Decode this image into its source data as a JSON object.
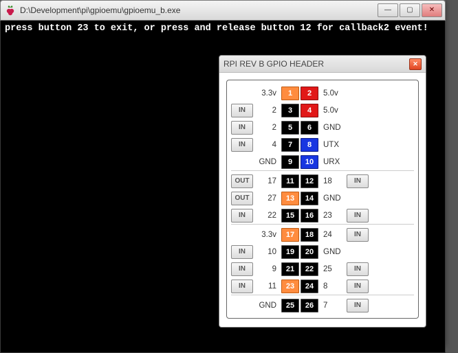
{
  "console": {
    "title_path": "D:\\Development\\pi\\gpioemu\\gpioemu_b.exe",
    "message": "press button 23 to exit, or press and release button 12 for callback2 event!"
  },
  "window_buttons": {
    "min": "—",
    "max": "▢",
    "close": "✕"
  },
  "gpio": {
    "dialog_title": "RPI REV B GPIO HEADER",
    "close_glyph": "✕",
    "rows": [
      {
        "sep": false,
        "left_btn": "",
        "left_label": "3.3v",
        "pin_l_num": "1",
        "pin_l_col": "c-orange",
        "pin_r_num": "2",
        "pin_r_col": "c-red",
        "right_label": "5.0v",
        "right_btn": ""
      },
      {
        "sep": false,
        "left_btn": "IN",
        "left_label": "2",
        "pin_l_num": "3",
        "pin_l_col": "c-black",
        "pin_r_num": "4",
        "pin_r_col": "c-red",
        "right_label": "5.0v",
        "right_btn": ""
      },
      {
        "sep": false,
        "left_btn": "IN",
        "left_label": "2",
        "pin_l_num": "5",
        "pin_l_col": "c-black",
        "pin_r_num": "6",
        "pin_r_col": "c-black",
        "right_label": "GND",
        "right_btn": ""
      },
      {
        "sep": false,
        "left_btn": "IN",
        "left_label": "4",
        "pin_l_num": "7",
        "pin_l_col": "c-black",
        "pin_r_num": "8",
        "pin_r_col": "c-blue",
        "right_label": "UTX",
        "right_btn": ""
      },
      {
        "sep": false,
        "left_btn": "",
        "left_label": "GND",
        "pin_l_num": "9",
        "pin_l_col": "c-black",
        "pin_r_num": "10",
        "pin_r_col": "c-blue",
        "right_label": "URX",
        "right_btn": ""
      },
      {
        "sep": true,
        "left_btn": "OUT",
        "left_label": "17",
        "pin_l_num": "11",
        "pin_l_col": "c-black",
        "pin_r_num": "12",
        "pin_r_col": "c-black",
        "right_label": "18",
        "right_btn": "IN"
      },
      {
        "sep": false,
        "left_btn": "OUT",
        "left_label": "27",
        "pin_l_num": "13",
        "pin_l_col": "c-orange",
        "pin_r_num": "14",
        "pin_r_col": "c-black",
        "right_label": "GND",
        "right_btn": ""
      },
      {
        "sep": false,
        "left_btn": "IN",
        "left_label": "22",
        "pin_l_num": "15",
        "pin_l_col": "c-black",
        "pin_r_num": "16",
        "pin_r_col": "c-black",
        "right_label": "23",
        "right_btn": "IN"
      },
      {
        "sep": true,
        "left_btn": "",
        "left_label": "3.3v",
        "pin_l_num": "17",
        "pin_l_col": "c-orange",
        "pin_r_num": "18",
        "pin_r_col": "c-black",
        "right_label": "24",
        "right_btn": "IN"
      },
      {
        "sep": false,
        "left_btn": "IN",
        "left_label": "10",
        "pin_l_num": "19",
        "pin_l_col": "c-black",
        "pin_r_num": "20",
        "pin_r_col": "c-black",
        "right_label": "GND",
        "right_btn": ""
      },
      {
        "sep": false,
        "left_btn": "IN",
        "left_label": "9",
        "pin_l_num": "21",
        "pin_l_col": "c-black",
        "pin_r_num": "22",
        "pin_r_col": "c-black",
        "right_label": "25",
        "right_btn": "IN"
      },
      {
        "sep": false,
        "left_btn": "IN",
        "left_label": "11",
        "pin_l_num": "23",
        "pin_l_col": "c-orange",
        "pin_r_num": "24",
        "pin_r_col": "c-black",
        "right_label": "8",
        "right_btn": "IN"
      },
      {
        "sep": true,
        "left_btn": "",
        "left_label": "GND",
        "pin_l_num": "25",
        "pin_l_col": "c-black",
        "pin_r_num": "26",
        "pin_r_col": "c-black",
        "right_label": "7",
        "right_btn": "IN"
      }
    ]
  }
}
